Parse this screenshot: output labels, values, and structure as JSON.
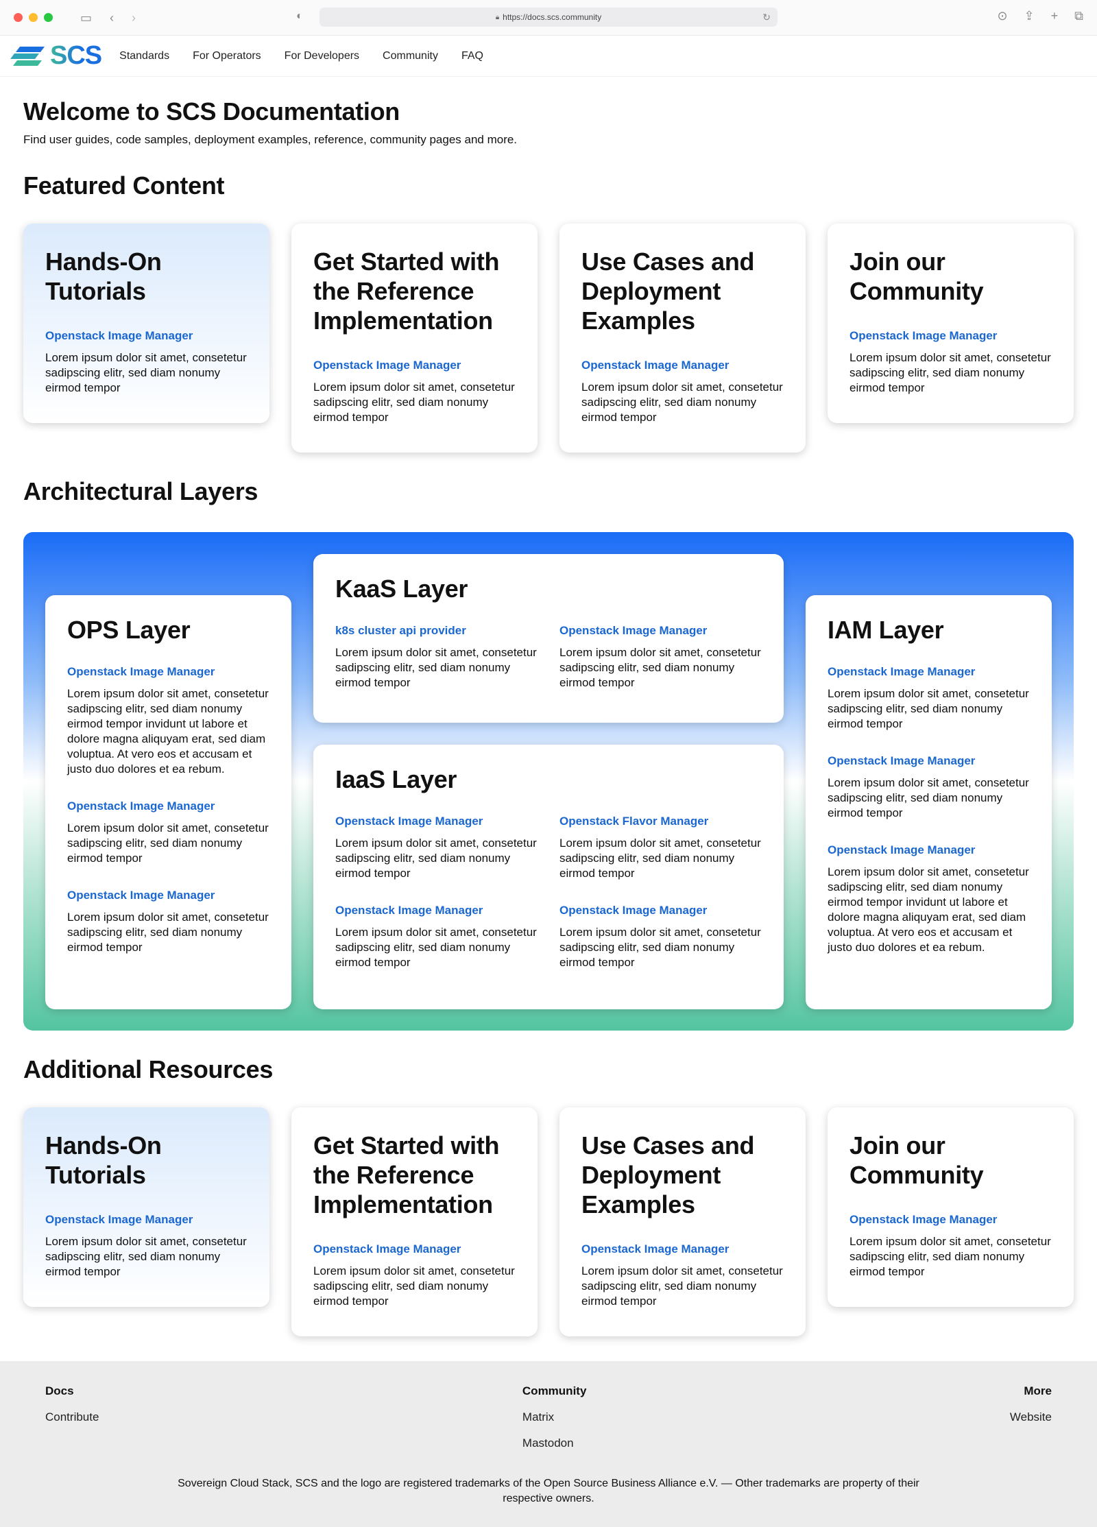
{
  "browser": {
    "url": "https://docs.scs.community"
  },
  "nav": {
    "logo_text": "SCS",
    "links": [
      "Standards",
      "For Operators",
      "For Developers",
      "Community",
      "FAQ"
    ]
  },
  "hero": {
    "title": "Welcome to SCS Documentation",
    "subtitle": "Find user guides, code samples, deployment examples, reference, community pages and more."
  },
  "featured": {
    "title": "Featured Content",
    "cards": [
      {
        "title": "Hands-On Tutorials",
        "link": "Openstack Image Manager",
        "text": "Lorem ipsum dolor sit amet, consetetur sadipscing elitr, sed diam nonumy eirmod tempor"
      },
      {
        "title": "Get Started with the Reference Implementation",
        "link": "Openstack Image Manager",
        "text": "Lorem ipsum dolor sit amet, consetetur sadipscing elitr, sed diam nonumy eirmod tempor"
      },
      {
        "title": "Use Cases and Deployment Examples",
        "link": "Openstack Image Manager",
        "text": "Lorem ipsum dolor sit amet, consetetur sadipscing elitr, sed diam nonumy eirmod tempor"
      },
      {
        "title": "Join our Community",
        "link": "Openstack Image Manager",
        "text": "Lorem ipsum dolor sit amet, consetetur sadipscing elitr, sed diam nonumy eirmod tempor"
      }
    ]
  },
  "architecture": {
    "title": "Architectural Layers",
    "ops": {
      "title": "OPS Layer",
      "items": [
        {
          "link": "Openstack Image Manager",
          "text": "Lorem ipsum dolor sit amet, consetetur sadipscing elitr, sed diam nonumy eirmod tempor invidunt ut labore et dolore magna aliquyam erat, sed diam voluptua. At vero eos et accusam et justo duo dolores et ea rebum."
        },
        {
          "link": "Openstack Image Manager",
          "text": "Lorem ipsum dolor sit amet, consetetur sadipscing elitr, sed diam nonumy eirmod tempor"
        },
        {
          "link": "Openstack Image Manager",
          "text": "Lorem ipsum dolor sit amet, consetetur sadipscing elitr, sed diam nonumy eirmod tempor"
        }
      ]
    },
    "kaas": {
      "title": "KaaS Layer",
      "items": [
        {
          "link": "k8s cluster api provider",
          "text": "Lorem ipsum dolor sit amet, consetetur sadipscing elitr, sed diam nonumy eirmod tempor"
        },
        {
          "link": "Openstack Image Manager",
          "text": "Lorem ipsum dolor sit amet, consetetur sadipscing elitr, sed diam nonumy eirmod tempor"
        }
      ]
    },
    "iaas": {
      "title": "IaaS Layer",
      "items": [
        {
          "link": "Openstack Image Manager",
          "text": "Lorem ipsum dolor sit amet, consetetur sadipscing elitr, sed diam nonumy eirmod tempor"
        },
        {
          "link": "Openstack Flavor Manager",
          "text": "Lorem ipsum dolor sit amet, consetetur sadipscing elitr, sed diam nonumy eirmod tempor"
        },
        {
          "link": "Openstack Image Manager",
          "text": "Lorem ipsum dolor sit amet, consetetur sadipscing elitr, sed diam nonumy eirmod tempor"
        },
        {
          "link": "Openstack Image Manager",
          "text": "Lorem ipsum dolor sit amet, consetetur sadipscing elitr, sed diam nonumy eirmod tempor"
        }
      ]
    },
    "iam": {
      "title": "IAM Layer",
      "items": [
        {
          "link": "Openstack Image Manager",
          "text": "Lorem ipsum dolor sit amet, consetetur sadipscing elitr, sed diam nonumy eirmod tempor"
        },
        {
          "link": "Openstack Image Manager",
          "text": "Lorem ipsum dolor sit amet, consetetur sadipscing elitr, sed diam nonumy eirmod tempor"
        },
        {
          "link": "Openstack Image Manager",
          "text": "Lorem ipsum dolor sit amet, consetetur sadipscing elitr, sed diam nonumy eirmod tempor invidunt ut labore et dolore magna aliquyam erat, sed diam voluptua. At vero eos et accusam et justo duo dolores et ea rebum."
        }
      ]
    }
  },
  "resources": {
    "title": "Additional Resources",
    "cards": [
      {
        "title": "Hands-On Tutorials",
        "link": "Openstack Image Manager",
        "text": "Lorem ipsum dolor sit amet, consetetur sadipscing elitr, sed diam nonumy eirmod tempor"
      },
      {
        "title": "Get Started with the Reference Implementation",
        "link": "Openstack Image Manager",
        "text": "Lorem ipsum dolor sit amet, consetetur sadipscing elitr, sed diam nonumy eirmod tempor"
      },
      {
        "title": "Use Cases and Deployment Examples",
        "link": "Openstack Image Manager",
        "text": "Lorem ipsum dolor sit amet, consetetur sadipscing elitr, sed diam nonumy eirmod tempor"
      },
      {
        "title": "Join our Community",
        "link": "Openstack Image Manager",
        "text": "Lorem ipsum dolor sit amet, consetetur sadipscing elitr, sed diam nonumy eirmod tempor"
      }
    ]
  },
  "footer": {
    "docs": {
      "title": "Docs",
      "links": [
        "Contribute"
      ]
    },
    "community": {
      "title": "Community",
      "links": [
        "Matrix",
        "Mastodon"
      ]
    },
    "more": {
      "title": "More",
      "links": [
        "Website"
      ]
    },
    "copyright": "Sovereign Cloud Stack, SCS and the logo are registered trademarks of the Open Source Business Alliance e.V. — Other trademarks are property of their respective owners."
  },
  "colors": {
    "link": "#1b67d0",
    "gradient_top": "#1a6cf7",
    "gradient_bottom": "#54c4a0",
    "footer_bg": "#ececec"
  }
}
